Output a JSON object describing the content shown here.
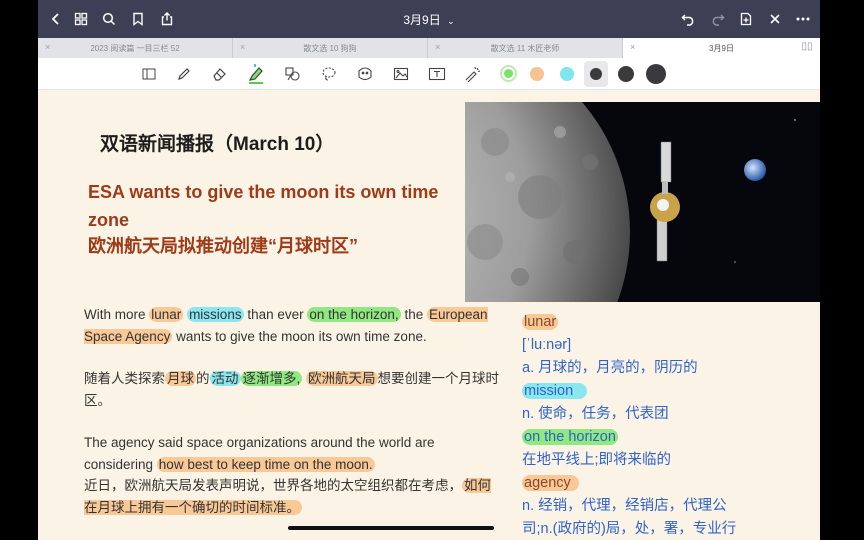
{
  "nav": {
    "title": "3月9日",
    "title_caret": "⌄",
    "icons": [
      "back-icon",
      "grid-icon",
      "search-icon",
      "bookmark-icon",
      "share-icon",
      "undo-icon",
      "redo-icon",
      "add-page-icon",
      "close-icon",
      "more-icon"
    ]
  },
  "tabs": [
    {
      "label": "2023 阅读篇 一目三栏 52",
      "active": false
    },
    {
      "label": "散文选 10 狗狗",
      "active": false
    },
    {
      "label": "散文选 11 木匠老师",
      "active": false
    },
    {
      "label": "3月9日",
      "active": true
    }
  ],
  "toolbar": {
    "tools": [
      "reading-mode-icon",
      "pen-icon",
      "eraser-icon",
      "highlighter-icon",
      "shapes-icon",
      "lasso-icon",
      "sticker-icon",
      "image-icon",
      "textbox-icon",
      "laser-icon"
    ],
    "colors": [
      "#7de26a",
      "#f6c28f",
      "#7fe6ee"
    ],
    "sizes_color": "#3a3a3c"
  },
  "page": {
    "title": "双语新闻播报（March 10）",
    "headline_en": "ESA wants to give the moon its own time zone",
    "headline_cn": "欧洲航天局拟推动创建“月球时区”",
    "p1": {
      "t1": "With more ",
      "h1": "lunar",
      "t2": " ",
      "h2": "missions",
      "t3": " than ever ",
      "h3": "on the horizon,",
      "t4": " the ",
      "h4": "European Space Agency",
      "t5": " wants to give the moon its own time zone."
    },
    "p1_cn": {
      "t1": "随着人类探索",
      "h1": "月球",
      "t2": "的",
      "h2": "活动",
      "h3": "逐渐增多,",
      "t3": " ",
      "h4": "欧洲航天局",
      "t4": "想要创建一个月球时区。"
    },
    "p2": {
      "t1": "The agency said space organizations around the world are considering ",
      "h1": "how best to keep time on the moon."
    },
    "p2_cn": {
      "t1": "近日，欧洲航天局发表声明说，世界各地的太空组织都在考虑，",
      "h1": "如何在月球上拥有一个确切的时间标准。"
    },
    "vocab": [
      {
        "word": "lunar",
        "style": "orange"
      },
      {
        "line": "[ˈluːnər]"
      },
      {
        "line": "a. 月球的，月亮的，阴历的"
      },
      {
        "word": "mission",
        "style": "cyan"
      },
      {
        "line": "n. 使命，任务，代表团"
      },
      {
        "word": "on the horizon",
        "style": "green"
      },
      {
        "line": "在地平线上;即将来临的"
      },
      {
        "word": "agency",
        "style": "orange"
      },
      {
        "line": "n. 经销，代理，经销店，代理公"
      },
      {
        "line": "司;n.(政府的)局，处，署，专业行"
      }
    ]
  }
}
